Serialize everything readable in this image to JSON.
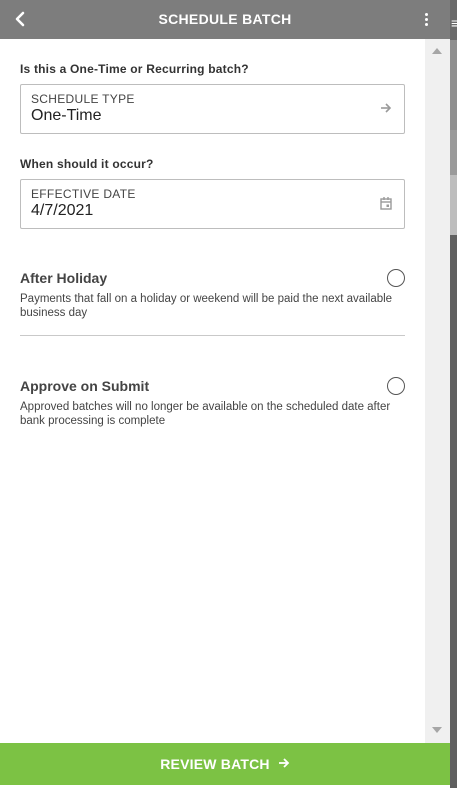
{
  "header": {
    "title": "SCHEDULE BATCH",
    "back_icon": "chevron-left-icon",
    "menu_icon": "kebab-menu-icon"
  },
  "schedule_type": {
    "question": "Is this a One-Time or Recurring batch?",
    "label": "SCHEDULE TYPE",
    "value": "One-Time",
    "icon": "arrow-right-icon"
  },
  "effective_date": {
    "question": "When should it occur?",
    "label": "EFFECTIVE DATE",
    "value": "4/7/2021",
    "icon": "calendar-icon"
  },
  "options": [
    {
      "title": "After Holiday",
      "description": "Payments that fall on a holiday or weekend will be paid the next available business day",
      "selected": false
    },
    {
      "title": "Approve on Submit",
      "description": "Approved batches will no longer be available on the scheduled date after bank processing is complete",
      "selected": false
    }
  ],
  "footer": {
    "button_label": "REVIEW BATCH",
    "button_icon": "arrow-right-icon"
  },
  "colors": {
    "header_bg": "#7d7d7d",
    "primary_green": "#7cc244"
  }
}
